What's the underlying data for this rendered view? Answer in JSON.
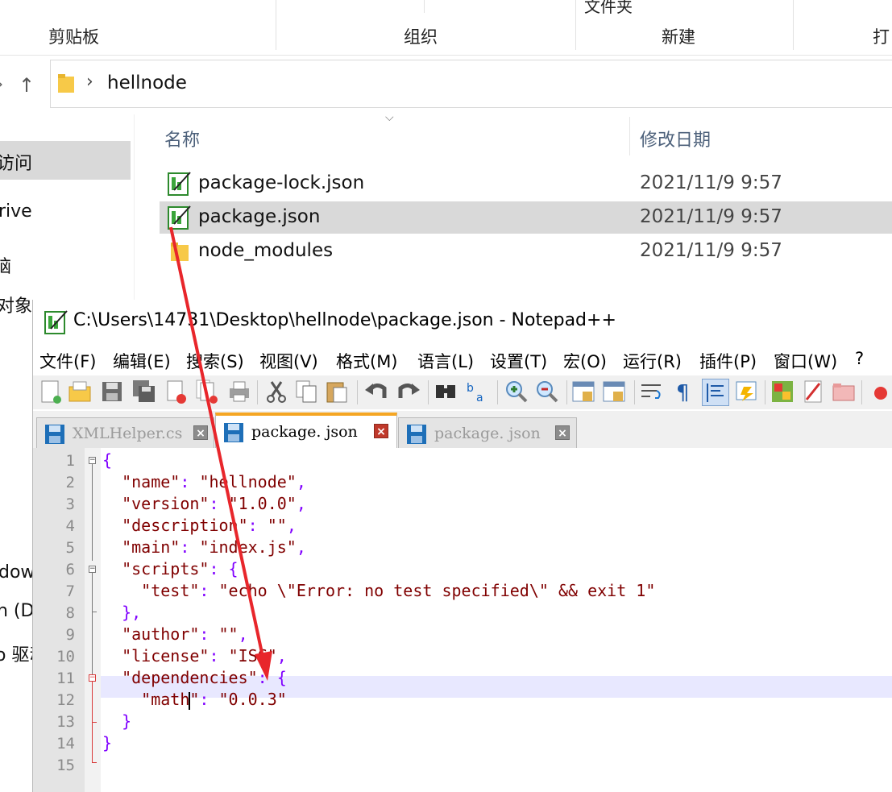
{
  "explorer": {
    "ribbon": {
      "groups": [
        "剪贴板",
        "组织",
        "新建",
        "打"
      ],
      "top_partial": "文件夹"
    },
    "address": {
      "path_segment": "hellnode"
    },
    "nav": {
      "items": [
        "访问",
        "rive",
        "脑",
        "对象",
        "dow",
        "n (D:",
        "o 驱动"
      ]
    },
    "columns": {
      "name": "名称",
      "modified": "修改日期"
    },
    "files": [
      {
        "name": "package-lock.json",
        "date": "2021/11/9 9:57",
        "icon": "notepad-json-icon"
      },
      {
        "name": "package.json",
        "date": "2021/11/9 9:57",
        "icon": "notepad-json-icon",
        "selected": true
      },
      {
        "name": "node_modules",
        "date": "2021/11/9 9:57",
        "icon": "folder-icon"
      }
    ]
  },
  "npp": {
    "title": "C:\\Users\\14731\\Desktop\\hellnode\\package.json - Notepad++",
    "menu": [
      "文件(F)",
      "编辑(E)",
      "搜索(S)",
      "视图(V)",
      "格式(M)",
      "语言(L)",
      "设置(T)",
      "宏(O)",
      "运行(R)",
      "插件(P)",
      "窗口(W)",
      "?"
    ],
    "tabs": [
      {
        "label": "XMLHelper.cs",
        "active": false
      },
      {
        "label": "package. json",
        "active": true
      },
      {
        "label": "package. json",
        "active": false
      }
    ],
    "line_numbers": [
      "1",
      "2",
      "3",
      "4",
      "5",
      "6",
      "7",
      "8",
      "9",
      "10",
      "11",
      "12",
      "13",
      "14",
      "15"
    ]
  },
  "colors": {
    "accent_tab": "#f5a623",
    "selection": "#d9d9d9",
    "current_line": "#e8e8ff",
    "arrow": "#e8262b"
  }
}
